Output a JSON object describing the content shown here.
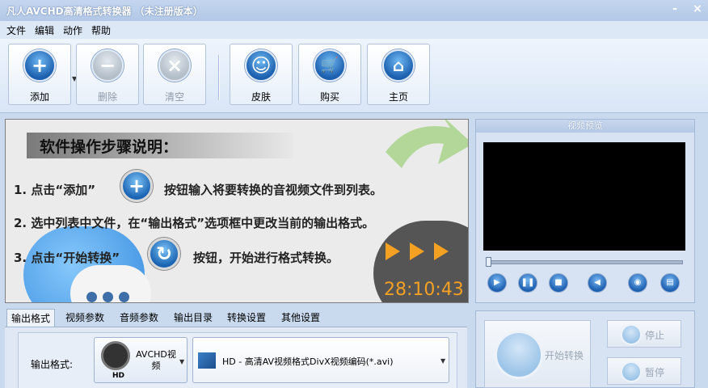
{
  "window": {
    "title": "凡人AVCHD高清格式转换器 （未注册版本）",
    "minimize": "-",
    "close": "×"
  },
  "menu": [
    "文件",
    "编辑",
    "动作",
    "帮助"
  ],
  "toolbar": {
    "add": "添加",
    "remove": "删除",
    "clear": "清空",
    "skin": "皮肤",
    "buy": "购买",
    "home": "主页"
  },
  "guide": {
    "heading": "软件操作步骤说明：",
    "step1_a": "1. 点击“添加”",
    "step1_b": "按钮输入将要转换的音视频文件到列表。",
    "step2": "2. 选中列表中文件，在“输出格式”选项框中更改当前的输出格式。",
    "step3_a": "3. 点击“开始转换”",
    "step3_b": "按钮，开始进行格式转换。",
    "time": "28:10:43"
  },
  "preview": {
    "title": "视频预览",
    "progress": 0
  },
  "tabs": [
    "输出格式",
    "视频参数",
    "音频参数",
    "输出目录",
    "转换设置",
    "其他设置"
  ],
  "output": {
    "label": "输出格式:",
    "format_name": "AVCHD视频",
    "format_badge": "HD",
    "profile": "HD - 高清AV视频格式DivX视频编码(*.avi)"
  },
  "controls": {
    "start": "开始转换",
    "stop": "停止",
    "pause": "暂停"
  }
}
